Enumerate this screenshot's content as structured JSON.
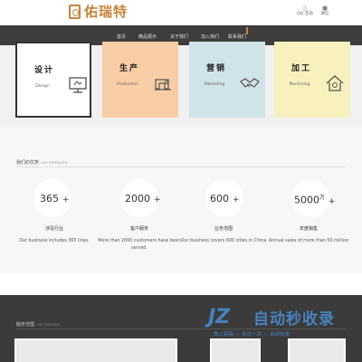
{
  "header": {
    "logo_text": "佑瑞特",
    "icons": [
      {
        "icon": "qq-icon",
        "label": "QQ 咨询"
      },
      {
        "icon": "wechat-icon",
        "label": "微信"
      }
    ]
  },
  "nav": {
    "items": [
      "首页",
      "精品展示",
      "关于我们",
      "加入我们",
      "联系我们"
    ]
  },
  "cards": [
    {
      "title": "设计",
      "sub": "Design",
      "icon": "monitor-icon",
      "color": "#ffffff"
    },
    {
      "title": "生产",
      "sub": "Production",
      "icon": "sewing-machine-icon",
      "color": "#f9cda6"
    },
    {
      "title": "营销",
      "sub": "Marketing",
      "icon": "handshake-icon",
      "color": "#cfe3e8"
    },
    {
      "title": "加工",
      "sub": "Machining",
      "icon": "house-icon",
      "color": "#f8f0bd"
    }
  ],
  "strength": {
    "title": "我们的优势",
    "title_en": "OUR STRENGTHS",
    "stats": [
      {
        "value": "365",
        "unit": "",
        "plus": "+",
        "name": "涉及行业",
        "desc": "Our business includes 365 lines."
      },
      {
        "value": "2000",
        "unit": "",
        "plus": "+",
        "name": "客户服务",
        "desc": "More than 2000 customers have been served."
      },
      {
        "value": "600",
        "unit": "",
        "plus": "+",
        "name": "业务范围",
        "desc": "Our business covers 600 cities in China"
      },
      {
        "value": "5000",
        "unit": "万",
        "plus": "+",
        "name": "年度销售",
        "desc": "Annual sales of more than 50 million"
      }
    ]
  },
  "services": {
    "title": "服务范围",
    "title_en": "OUR SERVICES"
  },
  "watermark": {
    "logo": "JZ",
    "text": "自动秒收录",
    "sub": "做上链接 — 来访一次 — 自动收录"
  }
}
